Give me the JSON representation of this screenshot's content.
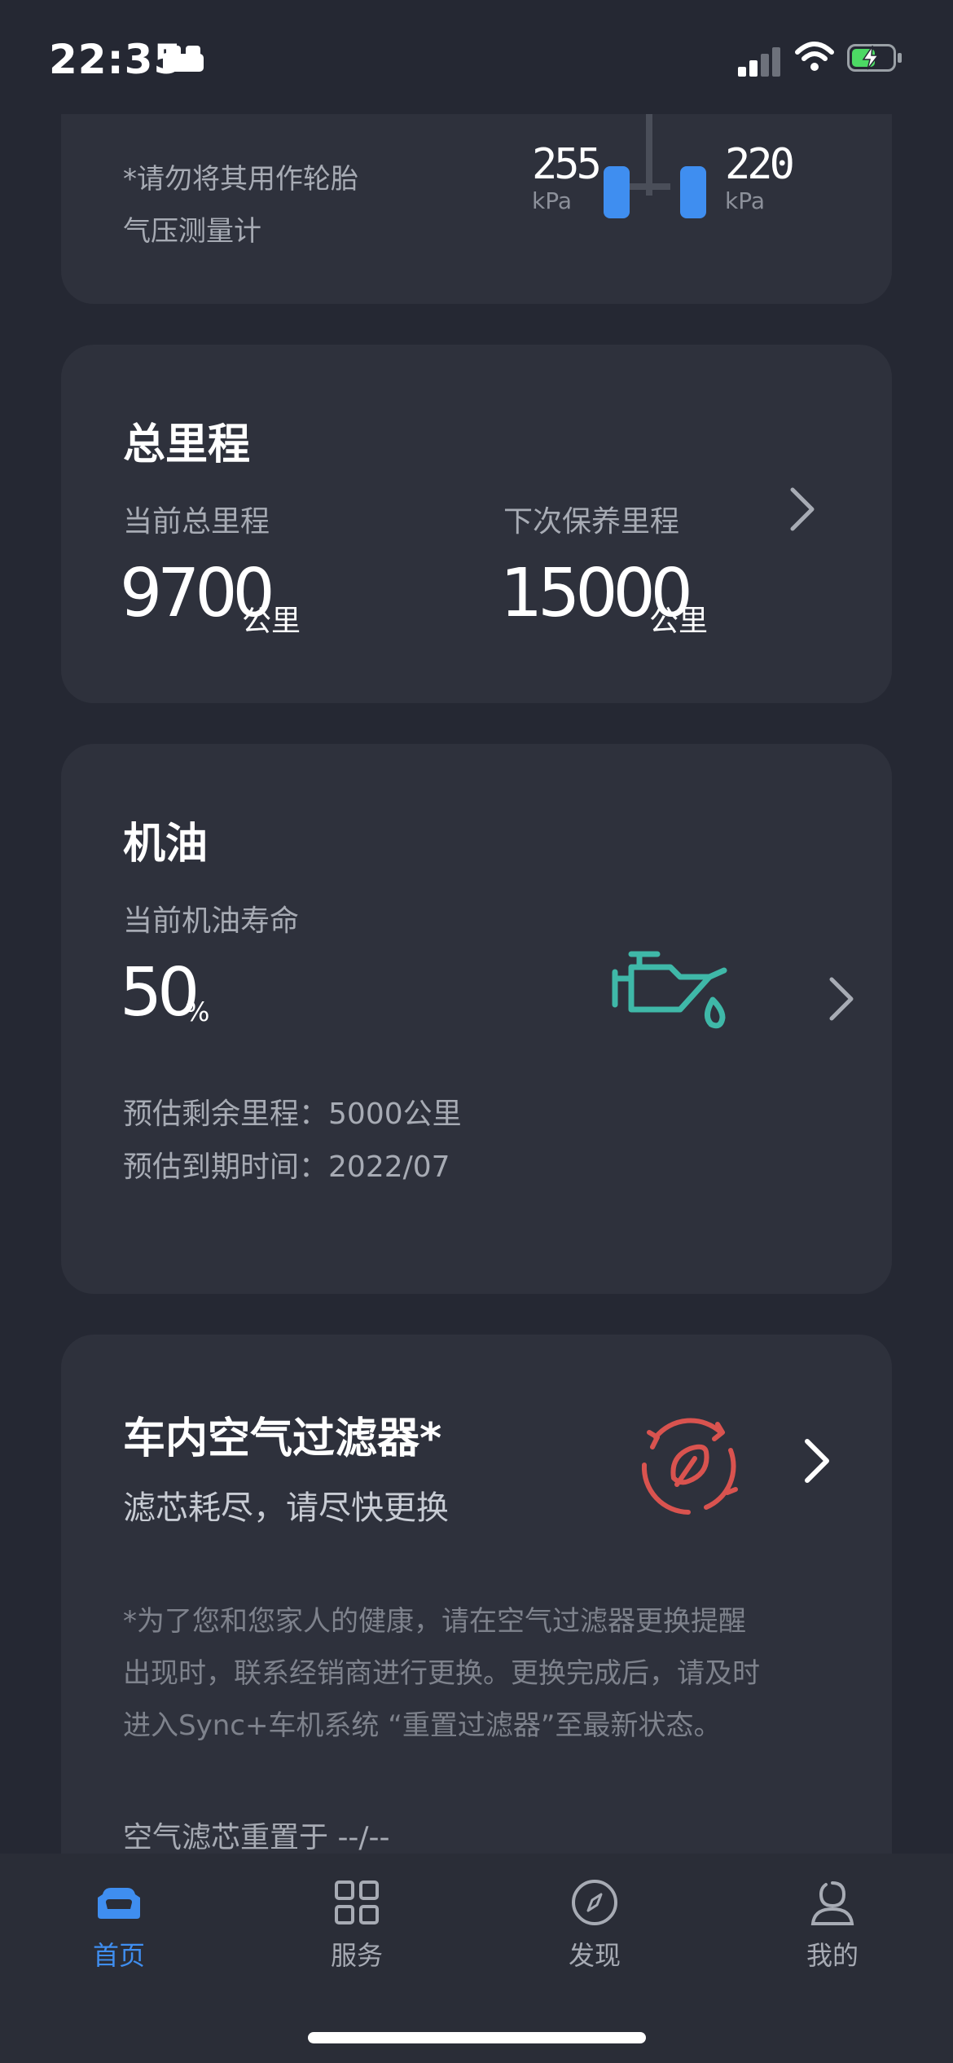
{
  "status_bar": {
    "time": "22:35",
    "icons": [
      "bed-icon",
      "signal-icon",
      "wifi-icon",
      "battery-charging-icon"
    ]
  },
  "tire_card": {
    "note_line1": "*请勿将其用作轮胎",
    "note_line2": "气压测量计",
    "left_pressure": "255",
    "right_pressure": "220",
    "unit": "kPa"
  },
  "mileage_card": {
    "title": "总里程",
    "current_label": "当前总里程",
    "current_value": "9700",
    "current_unit": "公里",
    "next_label": "下次保养里程",
    "next_value": "15000",
    "next_unit": "公里"
  },
  "oil_card": {
    "title": "机油",
    "life_label": "当前机油寿命",
    "life_value": "50",
    "life_unit": "%",
    "remaining_label": "预估剩余里程：",
    "remaining_value": "5000公里",
    "due_label": "预估到期时间：",
    "due_value": "2022/07",
    "icon": "oil-can-icon"
  },
  "filter_card": {
    "title": "车内空气过滤器*",
    "status": "滤芯耗尽，请尽快更换",
    "note_line1": "*为了您和您家人的健康，请在空气过滤器更换提醒",
    "note_line2": "出现时，联系经销商进行更换。更换完成后，请及时",
    "note_line3": "进入Sync+车机系统 “重置过滤器”至最新状态。",
    "reset_text": "空气滤芯重置于 --/--",
    "icon": "leaf-recycle-icon"
  },
  "tabbar": {
    "tabs": [
      {
        "label": "首页",
        "icon": "car-icon"
      },
      {
        "label": "服务",
        "icon": "grid-icon"
      },
      {
        "label": "发现",
        "icon": "compass-icon"
      },
      {
        "label": "我的",
        "icon": "user-icon"
      }
    ]
  },
  "colors": {
    "background": "#252833",
    "card": "#2e313c",
    "accent": "#3f8ef0",
    "oil_icon": "#3fb8a8",
    "filter_icon": "#d9534f"
  }
}
